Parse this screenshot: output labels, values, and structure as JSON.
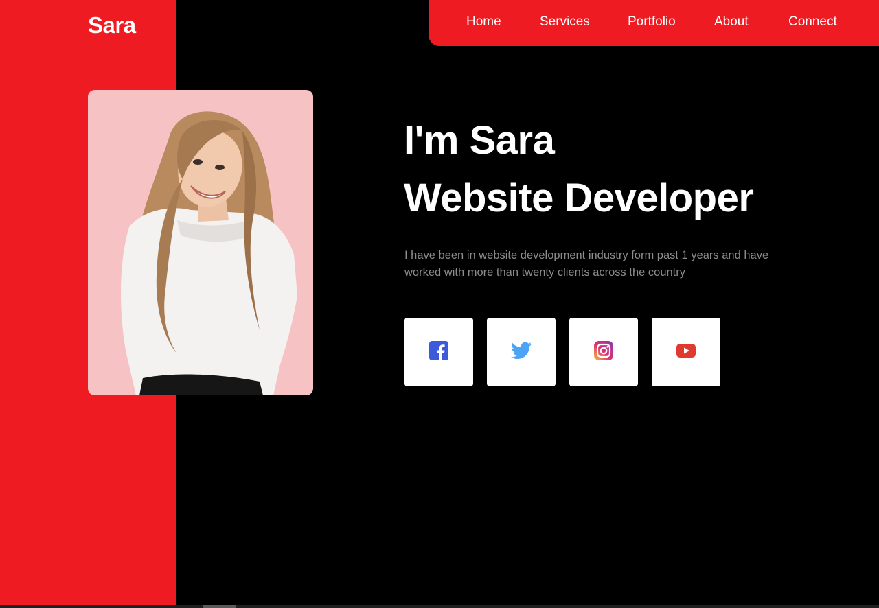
{
  "brand": {
    "name": "Sara"
  },
  "nav": {
    "items": [
      {
        "label": "Home"
      },
      {
        "label": "Services"
      },
      {
        "label": "Portfolio"
      },
      {
        "label": "About"
      },
      {
        "label": "Connect"
      }
    ]
  },
  "hero": {
    "greeting": "I'm Sara",
    "role": "Website Developer",
    "bio": "I have been in website development industry form past 1 years and have worked with more than twenty clients across the country"
  },
  "socials": [
    {
      "icon": "facebook-icon",
      "color": "#3b5bdb"
    },
    {
      "icon": "twitter-icon",
      "color": "#4da3f5"
    },
    {
      "icon": "instagram-icon",
      "color": "#e1306c"
    },
    {
      "icon": "youtube-icon",
      "color": "#e03a2f"
    }
  ],
  "colors": {
    "accent": "#ee1c22",
    "background": "#000000",
    "portrait_bg": "#f7c2c3",
    "bio_text": "#8c8c8c"
  }
}
